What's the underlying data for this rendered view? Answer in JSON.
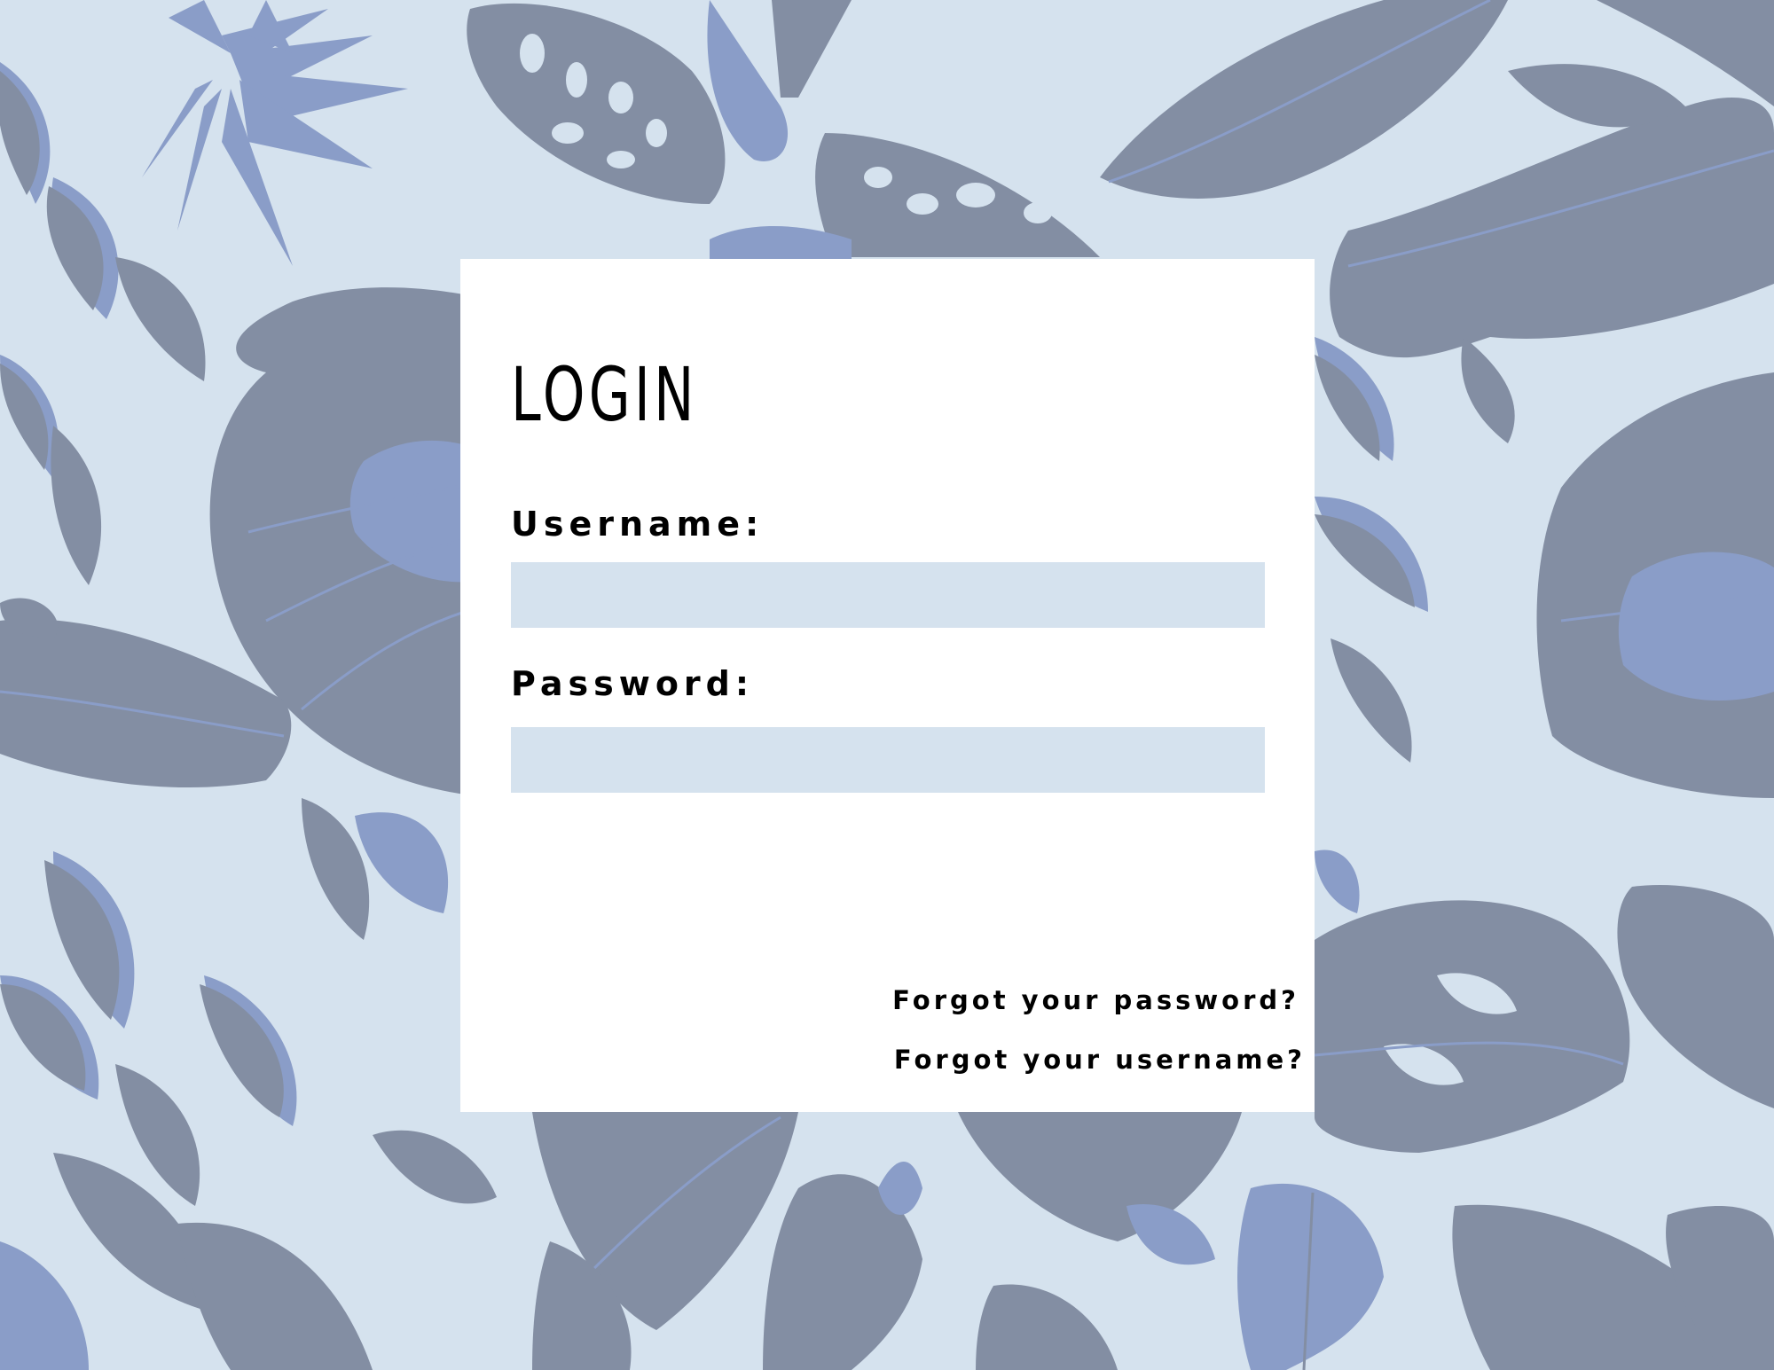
{
  "colors": {
    "background": "#d5e2ee",
    "leaf_dark": "#838ea3",
    "leaf_light": "#8a9dc8",
    "card": "#ffffff",
    "input_fill": "#d5e2ee",
    "text": "#000000"
  },
  "login": {
    "title": "LOGIN",
    "username_label": "Username:",
    "username_value": "",
    "password_label": "Password:",
    "password_value": "",
    "forgot_password": "Forgot your password?",
    "forgot_username": "Forgot your username?"
  },
  "background": {
    "pattern": "tropical-leaves"
  }
}
